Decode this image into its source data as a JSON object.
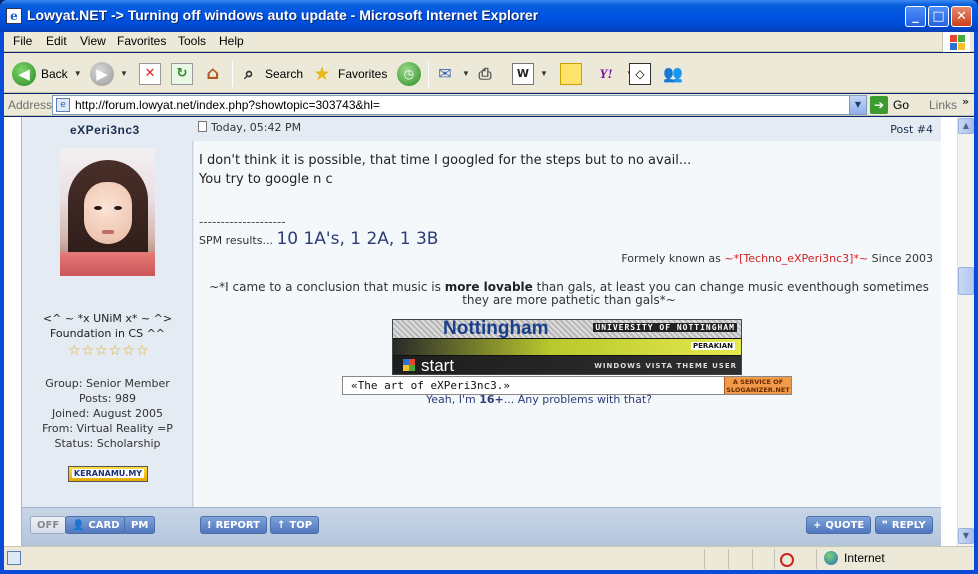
{
  "window": {
    "title": "Lowyat.NET -> Turning off windows auto update - Microsoft Internet Explorer",
    "min_glyph": "_",
    "max_glyph": "□",
    "close_glyph": "✕"
  },
  "menubar": {
    "items": [
      "File",
      "Edit",
      "View",
      "Favorites",
      "Tools",
      "Help"
    ]
  },
  "toolbar": {
    "back_label": "Back",
    "search_label": "Search",
    "favorites_label": "Favorites"
  },
  "addressbar": {
    "label": "Address",
    "url": "http://forum.lowyat.net/index.php?showtopic=303743&hl=",
    "go_label": "Go",
    "links_label": "Links"
  },
  "post": {
    "author": "eXPeri3nc3",
    "timestamp": "Today, 05:42 PM",
    "post_number": "Post #4",
    "body_lines": [
      "I don't think it is possible, that time I googled for the steps but to no avail...",
      "You try to google n c"
    ],
    "signature": {
      "separator": "--------------------",
      "spm_label": "SPM results...",
      "spm_grades": "10 1A's, 1 2A, 1 3B",
      "formerly_prefix": "Formely known as",
      "formerly_nick": "~*[Techno_eXPeri3nc3]*~",
      "formerly_suffix": "Since 2003",
      "quote_before": "~*I came to a conclusion that music is",
      "quote_bold": "more lovable",
      "quote_after": "than gals, at least you can change music eventhough sometimes they are more pathetic than gals*~",
      "banner_nottingham": "Nottingham",
      "banner_university": "UNIVERSITY OF NOTTINGHAM",
      "banner_perakian": "PERAKIAN",
      "banner_start": "start",
      "banner_vista": "WINDOWS VISTA THEME USER",
      "slogan_text": "«The art of eXPeri3nc3.»",
      "slogan_service": "A SERVICE OF SLOGANIZER.NET",
      "yeah_before": "Yeah, I'm",
      "yeah_bold": "16+",
      "yeah_after": "... Any problems with that?"
    }
  },
  "user": {
    "title_line1": "<^ ~ *x UNiM x* ~ ^>",
    "title_line2": "Foundation in CS ^^",
    "pips": 6,
    "group": "Group: Senior Member",
    "posts": "Posts: 989",
    "joined": "Joined: August 2005",
    "from": "From: Virtual Reality =P",
    "status": "Status: Scholarship",
    "badge_text": "KERANAMU.MY"
  },
  "post_buttons": {
    "off": "OFF",
    "card": "CARD",
    "pm": "PM",
    "report": "REPORT",
    "top": "TOP",
    "quote": "QUOTE",
    "reply": "REPLY"
  },
  "statusbar": {
    "zone": "Internet"
  },
  "colors": {
    "titlebar": "#0054e3",
    "forum_bg": "#e4ebf3",
    "post_bg": "#f5f8fb",
    "accent_red": "#d02020",
    "button_blue": "#4f77bf"
  }
}
